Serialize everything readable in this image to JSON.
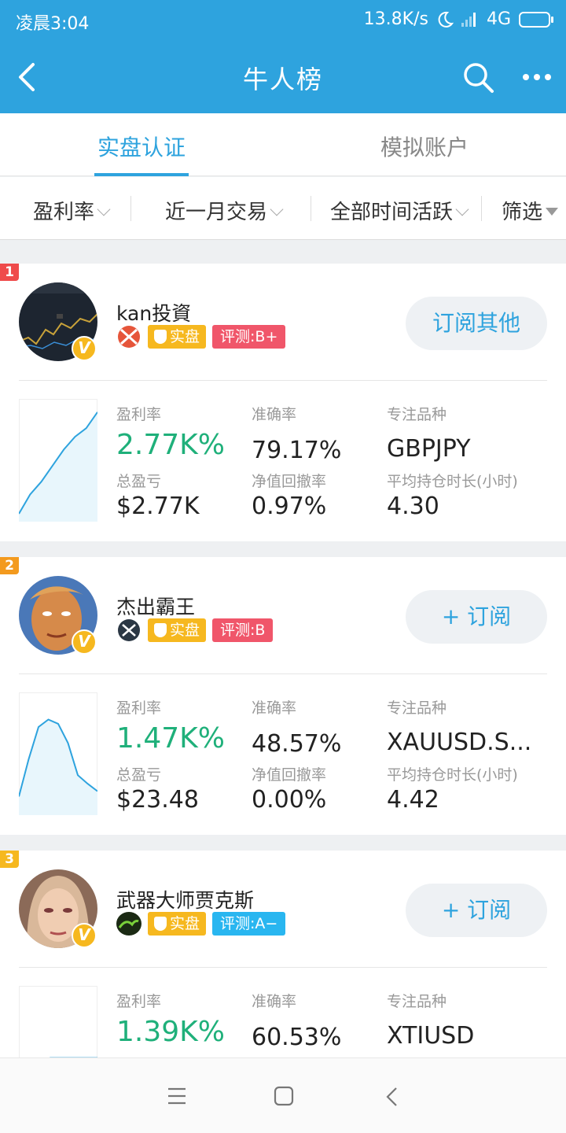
{
  "status_bar": {
    "time": "凌晨3:04",
    "speed": "13.8K/s",
    "network": "4G"
  },
  "header": {
    "title": "牛人榜"
  },
  "tabs": [
    {
      "label": "实盘认证",
      "active": true
    },
    {
      "label": "模拟账户",
      "active": false
    }
  ],
  "filters": [
    {
      "label": "盈利率"
    },
    {
      "label": "近一月交易"
    },
    {
      "label": "全部时间活跃"
    },
    {
      "label": "筛选"
    }
  ],
  "traders": [
    {
      "rank": "1",
      "name": "kan投資",
      "real_tag": "实盘",
      "grade": "评测:B+",
      "grade_color": "#f0566a",
      "button": "订阅其他",
      "profit_rate_label": "盈利率",
      "profit_rate": "2.77K%",
      "total_pl_label": "总盈亏",
      "total_pl": "$2.77K",
      "accuracy_label": "准确率",
      "accuracy": "79.17%",
      "drawdown_label": "净值回撤率",
      "drawdown": "0.97%",
      "focus_label": "专注品种",
      "focus": "GBPJPY",
      "hold_label": "平均持仓时长(小时)",
      "hold": "4.30",
      "curve": [
        0.0,
        0.18,
        0.3,
        0.45,
        0.6,
        0.72,
        0.8,
        0.95
      ]
    },
    {
      "rank": "2",
      "name": "杰出霸王",
      "real_tag": "实盘",
      "grade": "评测:B",
      "grade_color": "#f0566a",
      "button": "+ 订阅",
      "profit_rate_label": "盈利率",
      "profit_rate": "1.47K%",
      "total_pl_label": "总盈亏",
      "total_pl": "$23.48",
      "accuracy_label": "准确率",
      "accuracy": "48.57%",
      "drawdown_label": "净值回撤率",
      "drawdown": "0.00%",
      "focus_label": "专注品种",
      "focus": "XAUUSD.S...",
      "hold_label": "平均持仓时长(小时)",
      "hold": "4.42",
      "curve": [
        0.1,
        0.45,
        0.75,
        0.82,
        0.78,
        0.6,
        0.3,
        0.22,
        0.15
      ]
    },
    {
      "rank": "3",
      "name": "武器大师贾克斯",
      "real_tag": "实盘",
      "grade": "评测:A−",
      "grade_color": "#29b6f0",
      "button": "+ 订阅",
      "profit_rate_label": "盈利率",
      "profit_rate": "1.39K%",
      "accuracy_label": "准确率",
      "accuracy": "60.53%",
      "focus_label": "专注品种",
      "focus": "XTIUSD",
      "curve": [
        0.0,
        0.35,
        0.4,
        0.4,
        0.4,
        0.4
      ]
    }
  ],
  "rank_colors": [
    "#ef4b4b",
    "#f39a1e",
    "#f6b81f"
  ],
  "colors": {
    "accent": "#2ea3de",
    "profit": "#1fb07a",
    "real_tag": "#f6b81f"
  },
  "nav": [
    "menu-icon",
    "home-square-icon",
    "back-chevron-icon"
  ]
}
